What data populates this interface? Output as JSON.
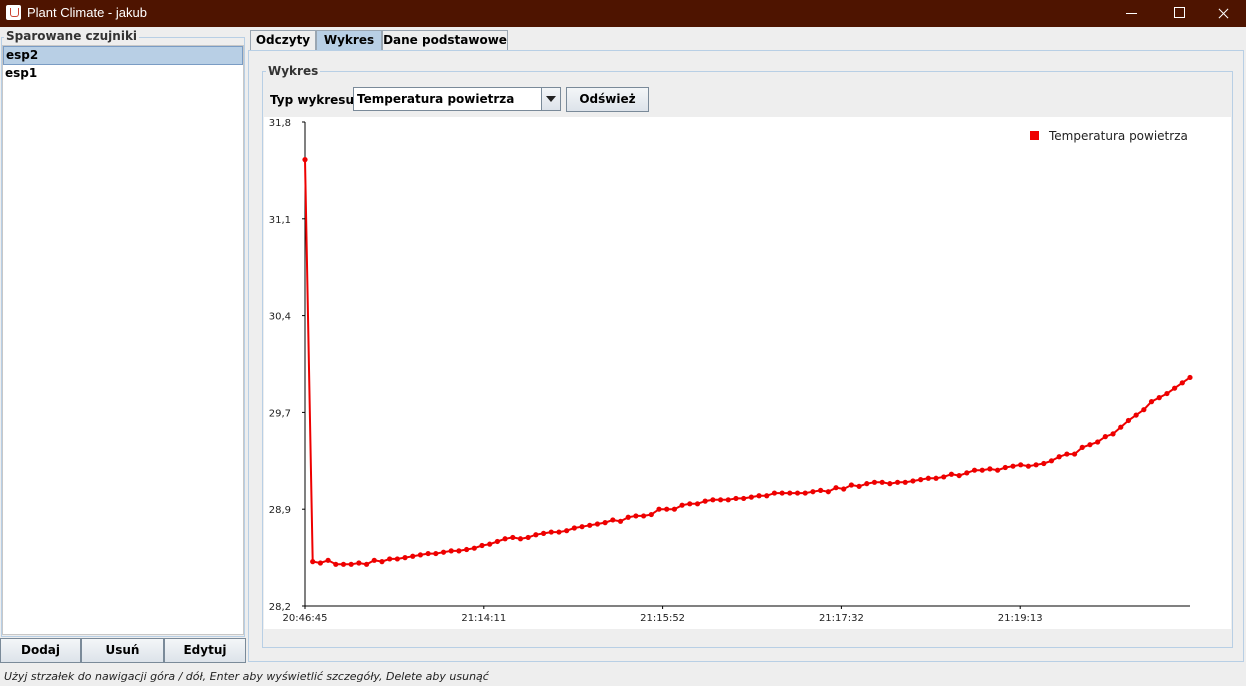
{
  "window": {
    "title": "Plant Climate - jakub"
  },
  "sensors": {
    "legend": "Sparowane czujniki",
    "items": [
      {
        "label": "esp2",
        "selected": true
      },
      {
        "label": "esp1",
        "selected": false
      }
    ],
    "buttons": {
      "add": "Dodaj",
      "remove": "Usuń",
      "edit": "Edytuj"
    }
  },
  "tabs": [
    {
      "label": "Odczyty",
      "active": false
    },
    {
      "label": "Wykres",
      "active": true
    },
    {
      "label": "Dane podstawowe",
      "active": false
    }
  ],
  "chart_panel": {
    "legend": "Wykres",
    "type_label": "Typ wykresu:",
    "type_value": "Temperatura powietrza",
    "refresh_label": "Odśwież"
  },
  "chart_data": {
    "type": "line",
    "title": "",
    "xlabel": "",
    "ylabel": "",
    "ylim": [
      28.2,
      31.8
    ],
    "y_ticks": [
      "28,2",
      "28,9",
      "29,7",
      "30,4",
      "31,1",
      "31,8"
    ],
    "x_ticks": [
      "20:46:45",
      "21:14:11",
      "21:15:52",
      "21:17:32",
      "21:19:13"
    ],
    "legend_position": "top-right",
    "color": "#ee0000",
    "series": [
      {
        "name": "Temperatura powietrza",
        "values": [
          31.52,
          28.53,
          28.52,
          28.54,
          28.51,
          28.51,
          28.51,
          28.52,
          28.51,
          28.54,
          28.53,
          28.55,
          28.55,
          28.56,
          28.57,
          28.58,
          28.59,
          28.59,
          28.6,
          28.61,
          28.61,
          28.62,
          28.63,
          28.65,
          28.66,
          28.68,
          28.7,
          28.71,
          28.7,
          28.71,
          28.73,
          28.74,
          28.75,
          28.75,
          28.76,
          28.78,
          28.79,
          28.8,
          28.81,
          28.82,
          28.84,
          28.83,
          28.86,
          28.87,
          28.87,
          28.88,
          28.92,
          28.92,
          28.92,
          28.95,
          28.96,
          28.96,
          28.98,
          28.99,
          28.99,
          28.99,
          29.0,
          29.0,
          29.01,
          29.02,
          29.02,
          29.04,
          29.04,
          29.04,
          29.04,
          29.04,
          29.05,
          29.06,
          29.05,
          29.08,
          29.07,
          29.1,
          29.09,
          29.11,
          29.12,
          29.12,
          29.11,
          29.12,
          29.12,
          29.13,
          29.14,
          29.15,
          29.15,
          29.16,
          29.18,
          29.17,
          29.19,
          29.21,
          29.21,
          29.22,
          29.21,
          29.23,
          29.24,
          29.25,
          29.24,
          29.25,
          29.26,
          29.28,
          29.31,
          29.33,
          29.33,
          29.38,
          29.4,
          29.42,
          29.46,
          29.48,
          29.53,
          29.58,
          29.62,
          29.66,
          29.72,
          29.75,
          29.78,
          29.82,
          29.86,
          29.9
        ]
      }
    ]
  },
  "status_bar": {
    "text": "Użyj strzałek do nawigacji góra / dół, Enter aby wyświetlić szczegóły, Delete aby usunąć"
  }
}
